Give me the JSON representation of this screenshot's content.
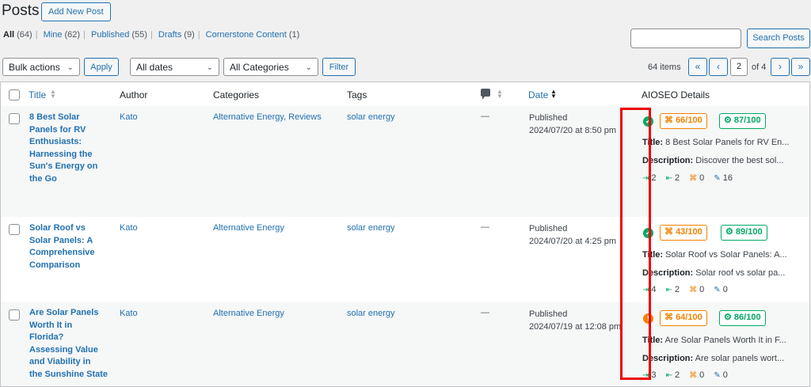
{
  "page": {
    "title": "Posts",
    "add_new": "Add New Post"
  },
  "filters": {
    "all": "All",
    "all_count": "(64)",
    "mine": "Mine",
    "mine_count": "(62)",
    "published": "Published",
    "published_count": "(55)",
    "drafts": "Drafts",
    "drafts_count": "(9)",
    "cornerstone": "Cornerstone Content",
    "cornerstone_count": "(1)"
  },
  "search": {
    "value": "",
    "button": "Search Posts"
  },
  "toolbar": {
    "bulk_actions": "Bulk actions",
    "apply": "Apply",
    "all_dates": "All dates",
    "all_categories": "All Categories",
    "filter": "Filter",
    "items": "64 items"
  },
  "pagination": {
    "first": "«",
    "prev": "‹",
    "current": "2",
    "of_total": "of 4",
    "next": "›",
    "last": "»"
  },
  "columns": {
    "title": "Title",
    "author": "Author",
    "categories": "Categories",
    "tags": "Tags",
    "date": "Date",
    "aioseo": "AIOSEO Details"
  },
  "labels": {
    "title_label": "Title:",
    "description_label": "Description:"
  },
  "posts": [
    {
      "title": "8 Best Solar Panels for RV Enthusiasts: Harnessing the Sun's Energy on the Go",
      "title_lines": [
        "8 Best Solar",
        "Panels for RV",
        "Enthusiasts:",
        "Harnessing the",
        "Sun's Energy on",
        "the Go"
      ],
      "author": "Kato",
      "categories": "Alternative Energy, Reviews",
      "tags": "solar energy",
      "comments": "—",
      "status": "Published",
      "date": "2024/07/20 at 8:50 pm",
      "seo_status": "ok",
      "seo_score": "66/100",
      "truseo_score": "87/100",
      "seo_title": "8 Best Solar Panels for RV En...",
      "seo_description": "Discover the best sol...",
      "stats": [
        "2",
        "2",
        "0",
        "16"
      ]
    },
    {
      "title": "Solar Roof vs Solar Panels: A Comprehensive Comparison",
      "title_lines": [
        "Solar Roof vs",
        "Solar Panels: A",
        "Comprehensive",
        "Comparison"
      ],
      "author": "Kato",
      "categories": "Alternative Energy",
      "tags": "solar energy",
      "comments": "—",
      "status": "Published",
      "date": "2024/07/20 at 4:25 pm",
      "seo_status": "ok",
      "seo_score": "43/100",
      "truseo_score": "89/100",
      "seo_title": "Solar Roof vs Solar Panels: A...",
      "seo_description": "Solar roof vs solar pa...",
      "stats": [
        "4",
        "2",
        "0",
        "0"
      ]
    },
    {
      "title": "Are Solar Panels Worth It in Florida? Assessing Value and Viability in the Sunshine State",
      "title_lines": [
        "Are Solar Panels",
        "Worth It in",
        "Florida?",
        "Assessing Value",
        "and Viability in",
        "the Sunshine State"
      ],
      "author": "Kato",
      "categories": "Alternative Energy",
      "tags": "solar energy",
      "comments": "—",
      "status": "Published",
      "date": "2024/07/19 at 12:08 pm",
      "seo_status": "warning",
      "seo_score": "64/100",
      "truseo_score": "86/100",
      "seo_title": "Are Solar Panels Worth It in F...",
      "seo_description": "Are solar panels wort...",
      "stats": [
        "3",
        "2",
        "0",
        "0"
      ]
    }
  ],
  "colors": {
    "link": "#2271b1",
    "ok": "#00aa63",
    "warning": "#f18200",
    "highlight": "#e00000"
  }
}
